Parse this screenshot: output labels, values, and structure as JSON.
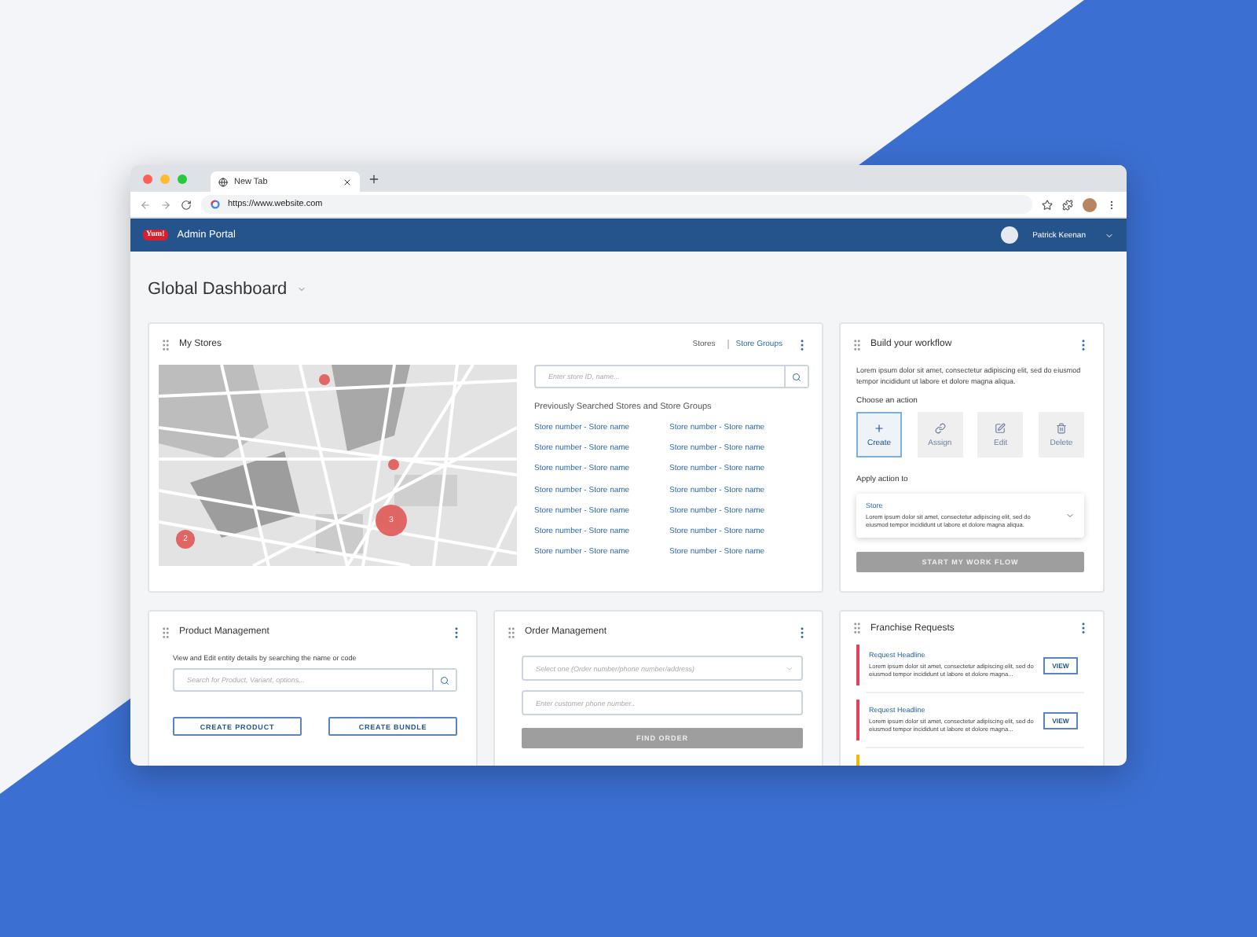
{
  "browser": {
    "tab_title": "New Tab",
    "url": "https://www.website.com"
  },
  "header": {
    "logo": "Yum!",
    "title": "Admin Portal",
    "user": "Patrick Keenan"
  },
  "page_title": "Global Dashboard",
  "my_stores": {
    "title": "My Stores",
    "links": [
      {
        "label": "Stores",
        "selected": false
      },
      {
        "label": "Store Groups",
        "selected": true
      }
    ],
    "map_markers": [
      {
        "kind": "dot"
      },
      {
        "kind": "dot"
      },
      {
        "kind": "cluster",
        "label": "2"
      },
      {
        "kind": "cluster",
        "label": "3"
      }
    ],
    "search_placeholder": "Enter store ID, name...",
    "history_title": "Previously Searched Stores and Store Groups",
    "stores": [
      "Store number - Store name",
      "Store number - Store name",
      "Store number - Store name",
      "Store number - Store name",
      "Store number - Store name",
      "Store number - Store name",
      "Store number - Store name",
      "Store number - Store name",
      "Store number - Store name",
      "Store number - Store name",
      "Store number - Store name",
      "Store number - Store name",
      "Store number - Store name",
      "Store number - Store name"
    ]
  },
  "workflow": {
    "title": "Build your workflow",
    "description": "Lorem ipsum dolor sit amet, consectetur adipiscing elit, sed do eiusmod tempor incididunt ut labore et dolore magna aliqua.",
    "choose_label": "Choose an action",
    "actions": [
      {
        "kind": "create",
        "label": "Create",
        "selected": true
      },
      {
        "kind": "assign",
        "label": "Assign",
        "selected": false
      },
      {
        "kind": "edit",
        "label": "Edit",
        "selected": false
      },
      {
        "kind": "delete",
        "label": "Delete",
        "selected": false
      }
    ],
    "apply_label": "Apply action to",
    "target": {
      "title": "Store",
      "description": "Lorem ipsum dolor sit amet, consectetur adipiscing elit, sed do eiusmod tempor incididunt ut labore et dolore magna aliqua."
    },
    "button": {
      "label": "START MY WORK FLOW",
      "disabled": true
    }
  },
  "product": {
    "title": "Product Management",
    "description": "View and Edit entity details by searching the name or code",
    "search_placeholder": "Search for Product, Variant, options...",
    "buttons": [
      "CREATE PRODUCT",
      "CREATE BUNDLE"
    ]
  },
  "order": {
    "title": "Order Management",
    "select_placeholder": "Select one (Order number/phone number/address)",
    "phone_placeholder": "Enter customer phone number..",
    "button": {
      "label": "FIND ORDER",
      "disabled": true
    }
  },
  "franchise": {
    "title": "Franchise Requests",
    "requests": [
      {
        "headline": "Request Headline",
        "text": "Lorem ipsum dolor sit amet, consectetur adipiscing elit, sed do eiusmod tempor incididunt ut labore et dolore magna...",
        "action": "VIEW",
        "color": "#e8405a"
      },
      {
        "headline": "Request Headline",
        "text": "Lorem ipsum dolor sit amet, consectetur adipiscing elit, sed do eiusmod tempor incididunt ut labore et dolore magna...",
        "action": "VIEW",
        "color": "#e8405a"
      },
      {
        "color": "#f2b705"
      }
    ]
  }
}
